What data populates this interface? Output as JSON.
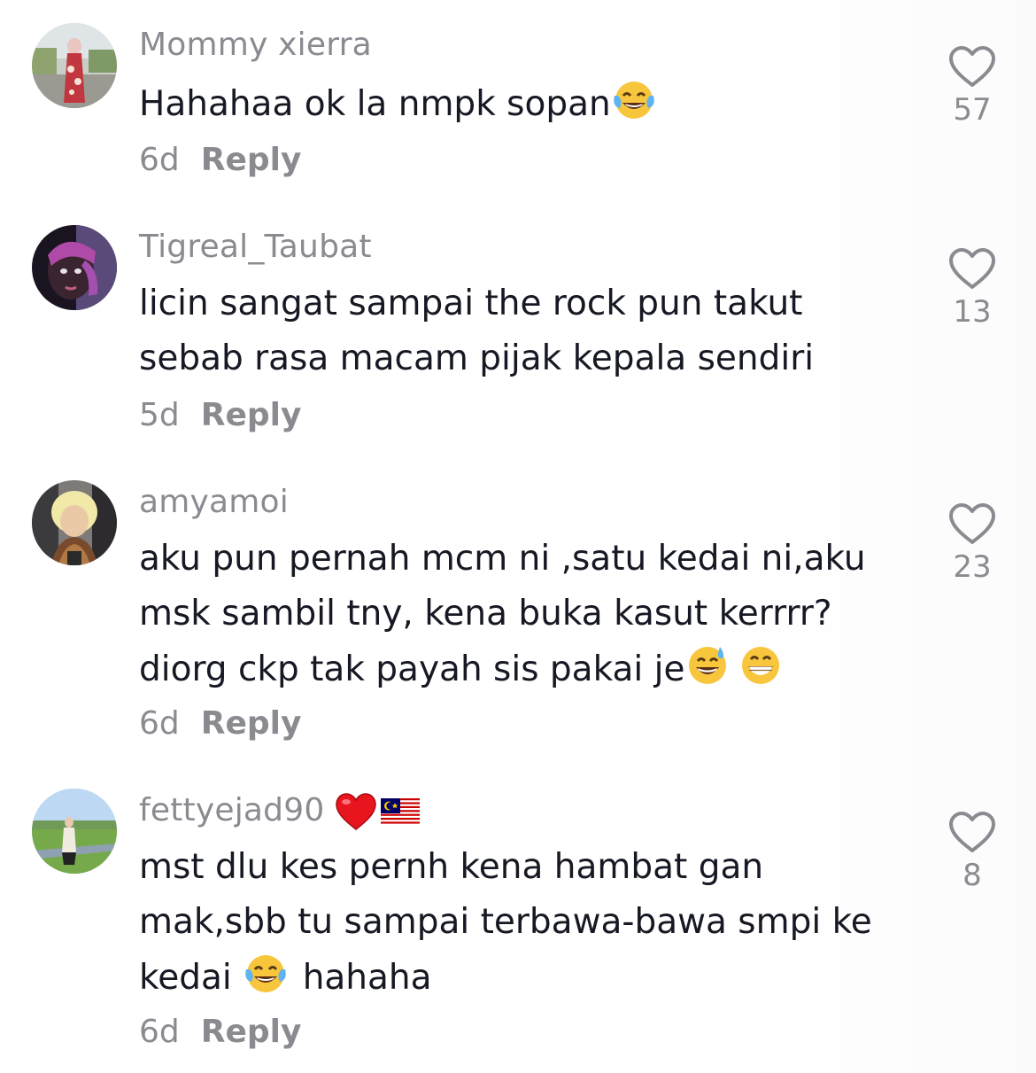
{
  "comments": [
    {
      "username": "Mommy xierra",
      "lines": [
        "Hahahaa ok la nmpk sopan"
      ],
      "emojis": [
        "tears-of-joy"
      ],
      "time": "6d",
      "reply": "Reply",
      "likes": "57"
    },
    {
      "username": "Tigreal_Taubat",
      "lines": [
        "licin sangat sampai the rock pun takut",
        "sebab rasa macam pijak kepala sendiri"
      ],
      "time": "5d",
      "reply": "Reply",
      "likes": "13"
    },
    {
      "username": "amyamoi",
      "lines": [
        "aku pun pernah mcm ni ,satu kedai ni,aku",
        "msk sambil tny, kena buka kasut kerrrr?",
        "diorg ckp tak payah sis pakai je"
      ],
      "emojis": [
        "grinning-sweat",
        "beaming-grin"
      ],
      "time": "6d",
      "reply": "Reply",
      "likes": "23"
    },
    {
      "username": "fettyejad90",
      "badges": [
        "red-heart",
        "malaysia-flag"
      ],
      "lines": [
        "mst dlu kes pernh kena hambat gan",
        "mak,sbb tu sampai terbawa-bawa smpi ke",
        "kedai",
        "hahaha"
      ],
      "emojis": [
        "tears-of-joy"
      ],
      "time": "6d",
      "reply": "Reply",
      "likes": "8"
    }
  ],
  "colors": {
    "primary_text": "#161823",
    "secondary_text": "#8a8b91",
    "icon": "#8a8b91",
    "background": "#ffffff"
  }
}
